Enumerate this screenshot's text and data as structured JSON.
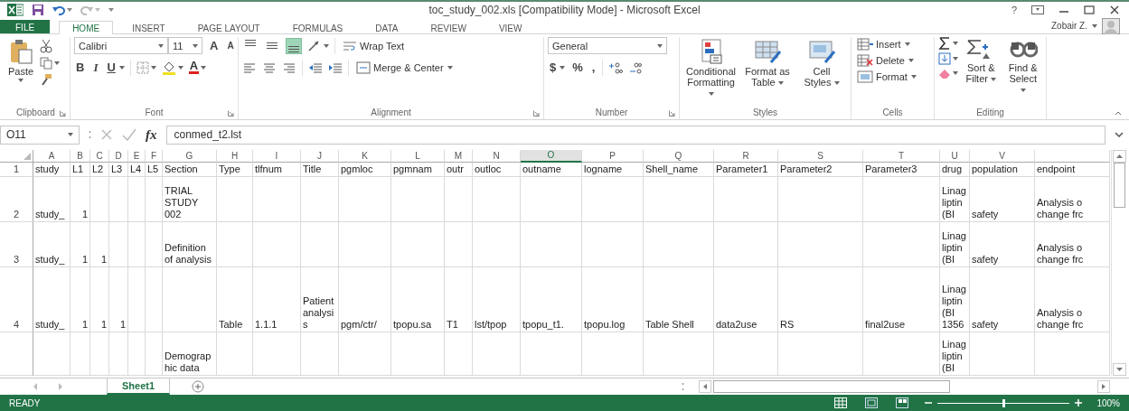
{
  "title_bar": {
    "title": "toc_study_002.xls  [Compatibility Mode] - Microsoft Excel",
    "help": "?"
  },
  "tabs": [
    {
      "label": "FILE",
      "kind": "file",
      "selected": false
    },
    {
      "label": "HOME",
      "kind": "tab",
      "selected": true
    },
    {
      "label": "INSERT",
      "kind": "tab",
      "selected": false
    },
    {
      "label": "PAGE LAYOUT",
      "kind": "tab",
      "selected": false
    },
    {
      "label": "FORMULAS",
      "kind": "tab",
      "selected": false
    },
    {
      "label": "DATA",
      "kind": "tab",
      "selected": false
    },
    {
      "label": "REVIEW",
      "kind": "tab",
      "selected": false
    },
    {
      "label": "VIEW",
      "kind": "tab",
      "selected": false
    }
  ],
  "account": {
    "name": "Zobair Z."
  },
  "ribbon": {
    "clipboard": {
      "label": "Clipboard",
      "paste": "Paste"
    },
    "font": {
      "label": "Font",
      "font_name": "Calibri",
      "font_size": "11",
      "grow": "A",
      "shrink": "A",
      "bold": "B",
      "italic": "I",
      "underline": "U",
      "font_color": "A"
    },
    "alignment": {
      "label": "Alignment",
      "align_buttons": [
        {
          "kind": "top",
          "selected": false
        },
        {
          "kind": "middle",
          "selected": false
        },
        {
          "kind": "bottom",
          "selected": true
        }
      ],
      "wrap_text": "Wrap Text",
      "merge": "Merge & Center"
    },
    "number": {
      "label": "Number",
      "format": "General",
      "currency": "$",
      "percent": "%",
      "comma": ","
    },
    "styles": {
      "label": "Styles",
      "buttons": [
        "Conditional Formatting",
        "Format as Table",
        "Cell Styles"
      ]
    },
    "cells": {
      "label": "Cells",
      "buttons": [
        "Insert",
        "Delete",
        "Format"
      ]
    },
    "editing": {
      "label": "Editing",
      "buttons": [
        "Sort & Filter",
        "Find & Select"
      ]
    }
  },
  "formula_bar": {
    "name_box": "O11",
    "function_label": "fx",
    "value": "conmed_t2.lst"
  },
  "sheet": {
    "columns": [
      {
        "label": "A",
        "selected": false
      },
      {
        "label": "B",
        "selected": false
      },
      {
        "label": "C",
        "selected": false
      },
      {
        "label": "D",
        "selected": false
      },
      {
        "label": "E",
        "selected": false
      },
      {
        "label": "F",
        "selected": false
      },
      {
        "label": "G",
        "selected": false
      },
      {
        "label": "H",
        "selected": false
      },
      {
        "label": "I",
        "selected": false
      },
      {
        "label": "J",
        "selected": false
      },
      {
        "label": "K",
        "selected": false
      },
      {
        "label": "L",
        "selected": false
      },
      {
        "label": "M",
        "selected": false
      },
      {
        "label": "N",
        "selected": false
      },
      {
        "label": "O",
        "selected": true
      },
      {
        "label": "P",
        "selected": false
      },
      {
        "label": "Q",
        "selected": false
      },
      {
        "label": "R",
        "selected": false
      },
      {
        "label": "S",
        "selected": false
      },
      {
        "label": "T",
        "selected": false
      },
      {
        "label": "U",
        "selected": false
      },
      {
        "label": "V",
        "selected": false
      }
    ],
    "rows": [
      {
        "label": "1",
        "cells": [
          {
            "text": "study",
            "kind": "text"
          },
          {
            "text": "L1",
            "kind": "text"
          },
          {
            "text": "L2",
            "kind": "text"
          },
          {
            "text": "L3",
            "kind": "text"
          },
          {
            "text": "L4",
            "kind": "text"
          },
          {
            "text": "L5",
            "kind": "text"
          },
          {
            "text": "Section",
            "kind": "text"
          },
          {
            "text": "Type",
            "kind": "text"
          },
          {
            "text": "tlfnum",
            "kind": "text"
          },
          {
            "text": "Title",
            "kind": "text"
          },
          {
            "text": "pgmloc",
            "kind": "text"
          },
          {
            "text": "pgmnam",
            "kind": "text"
          },
          {
            "text": "outr",
            "kind": "text"
          },
          {
            "text": "outloc",
            "kind": "text"
          },
          {
            "text": "outname",
            "kind": "text"
          },
          {
            "text": "logname",
            "kind": "text"
          },
          {
            "text": "Shell_name",
            "kind": "text"
          },
          {
            "text": "Parameter1",
            "kind": "text"
          },
          {
            "text": "Parameter2",
            "kind": "text"
          },
          {
            "text": "Parameter3",
            "kind": "text"
          },
          {
            "text": "drug",
            "kind": "text"
          },
          {
            "text": "population",
            "kind": "text"
          },
          {
            "text": "endpoint",
            "kind": "text"
          }
        ]
      },
      {
        "label": "2",
        "cells": [
          {
            "text": "study_",
            "kind": "text"
          },
          {
            "text": "1",
            "kind": "number"
          },
          null,
          null,
          null,
          null,
          {
            "text": "TRIAL STUDY 002",
            "kind": "text"
          },
          null,
          null,
          null,
          null,
          null,
          null,
          null,
          null,
          null,
          null,
          null,
          null,
          null,
          {
            "text": "Linagliptin (BI",
            "kind": "text"
          },
          {
            "text": "safety",
            "kind": "text"
          },
          {
            "text": "Analysis o change frc",
            "kind": "text"
          }
        ]
      },
      {
        "label": "3",
        "cells": [
          {
            "text": "study_",
            "kind": "text"
          },
          {
            "text": "1",
            "kind": "number"
          },
          {
            "text": "1",
            "kind": "number"
          },
          null,
          null,
          null,
          {
            "text": "Definition of analysis",
            "kind": "text"
          },
          null,
          null,
          null,
          null,
          null,
          null,
          null,
          null,
          null,
          null,
          null,
          null,
          null,
          {
            "text": "Linagliptin (BI",
            "kind": "text"
          },
          {
            "text": "safety",
            "kind": "text"
          },
          {
            "text": "Analysis o change frc",
            "kind": "text"
          }
        ]
      },
      {
        "label": "4",
        "cells": [
          {
            "text": "study_",
            "kind": "text"
          },
          {
            "text": "1",
            "kind": "number"
          },
          {
            "text": "1",
            "kind": "number"
          },
          {
            "text": "1",
            "kind": "number"
          },
          null,
          null,
          null,
          {
            "text": "Table",
            "kind": "text"
          },
          {
            "text": "1.1.1",
            "kind": "text"
          },
          {
            "text": "Patient analysis",
            "kind": "text"
          },
          {
            "text": "pgm/ctr/",
            "kind": "text"
          },
          {
            "text": "tpopu.sa",
            "kind": "text"
          },
          {
            "text": "T1",
            "kind": "text"
          },
          {
            "text": "lst/tpop",
            "kind": "text"
          },
          {
            "text": "tpopu_t1.",
            "kind": "text"
          },
          {
            "text": "tpopu.log",
            "kind": "text"
          },
          {
            "text": "Table Shell",
            "kind": "text"
          },
          {
            "text": "data2use",
            "kind": "text"
          },
          {
            "text": "RS",
            "kind": "text"
          },
          {
            "text": "final2use",
            "kind": "text"
          },
          {
            "text": "Linagliptin (BI 1356",
            "kind": "text"
          },
          {
            "text": "safety",
            "kind": "text"
          },
          {
            "text": "Analysis o change frc",
            "kind": "text"
          }
        ]
      },
      {
        "cells": [
          null,
          null,
          null,
          null,
          null,
          null,
          {
            "text": "Demographic data",
            "kind": "text"
          },
          null,
          null,
          null,
          null,
          null,
          null,
          null,
          null,
          null,
          null,
          null,
          null,
          null,
          {
            "text": "Linagliptin (BI",
            "kind": "text"
          },
          null,
          null
        ]
      }
    ]
  },
  "sheet_tabs": [
    {
      "label": "Sheet1",
      "selected": true
    }
  ],
  "status_bar": {
    "mode": "READY",
    "zoom": {
      "level": 0.5
    },
    "zoom_label": "100%"
  }
}
